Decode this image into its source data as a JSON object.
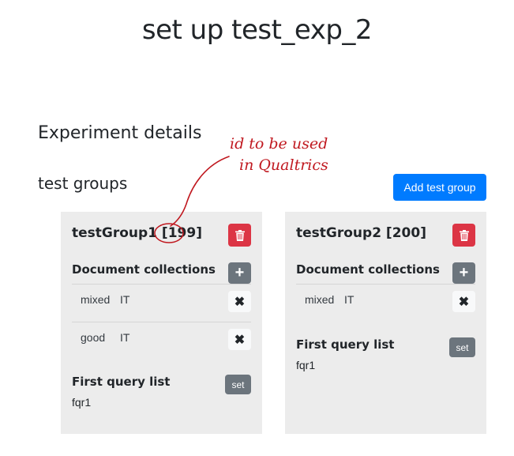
{
  "page": {
    "title": "set up test_exp_2"
  },
  "sections": {
    "details_title": "Experiment details",
    "groups_title": "test groups",
    "add_group_label": "Add test group"
  },
  "groups": [
    {
      "title": "testGroup1 [199]",
      "doc_collections_title": "Document collections",
      "documents": [
        {
          "name": "mixed",
          "lang": "IT"
        },
        {
          "name": "good",
          "lang": "IT"
        }
      ],
      "query_list_title": "First query list",
      "set_label": "set",
      "query_list_value": "fqr1"
    },
    {
      "title": "testGroup2 [200]",
      "doc_collections_title": "Document collections",
      "documents": [
        {
          "name": "mixed",
          "lang": "IT"
        }
      ],
      "query_list_title": "First query list",
      "set_label": "set",
      "query_list_value": "fqr1"
    }
  ],
  "annotation": {
    "line1": "id to be used",
    "line2": "in Qualtrics"
  },
  "icons": {
    "delete": "trash-icon",
    "add": "plus-icon",
    "remove": "close-icon"
  },
  "colors": {
    "primary": "#007bff",
    "danger": "#dc3545",
    "secondary": "#6c757d",
    "card_bg": "#ececec",
    "annotation": "#c0181f"
  }
}
